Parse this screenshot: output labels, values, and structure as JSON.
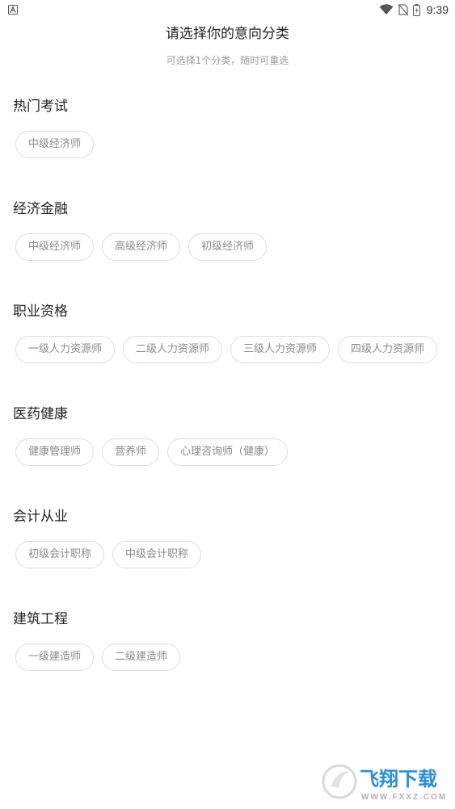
{
  "status_bar": {
    "time": "9:39",
    "icons": [
      "a-icon",
      "wifi-icon",
      "no-sim-icon",
      "battery-icon"
    ]
  },
  "header": {
    "title": "请选择你的意向分类",
    "subtitle": "可选择1个分类，随时可重选"
  },
  "sections": [
    {
      "title": "热门考试",
      "chips": [
        "中级经济师"
      ]
    },
    {
      "title": "经济金融",
      "chips": [
        "中级经济师",
        "高级经济师",
        "初级经济师"
      ]
    },
    {
      "title": "职业资格",
      "chips": [
        "一级人力资源师",
        "二级人力资源师",
        "三级人力资源师",
        "四级人力资源师"
      ]
    },
    {
      "title": "医药健康",
      "chips": [
        "健康管理师",
        "营养师",
        "心理咨询师（健康）"
      ]
    },
    {
      "title": "会计从业",
      "chips": [
        "初级会计职称",
        "中级会计职称"
      ]
    },
    {
      "title": "建筑工程",
      "chips": [
        "一级建造师",
        "二级建造师"
      ]
    }
  ],
  "watermark": {
    "text": "飞翔下载",
    "url_text": "WWW.FXXZ.COM"
  },
  "colors": {
    "chip_border": "#dcdcdc",
    "chip_text": "#8a8a8a",
    "subtitle": "#9a9a9a",
    "watermark_blue": "#2a8fd8"
  }
}
